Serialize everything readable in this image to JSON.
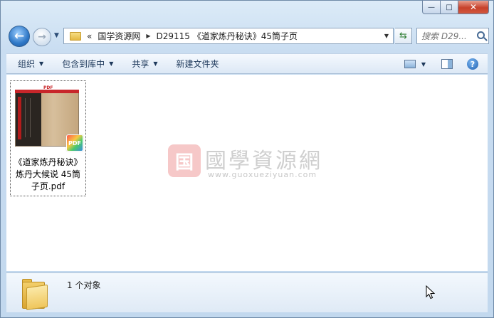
{
  "window": {
    "controls": {
      "minimize": "—",
      "maximize": "□",
      "close": "✕"
    }
  },
  "nav": {
    "back_glyph": "←",
    "forward_glyph": "→",
    "history_glyph": "▼",
    "address": {
      "overflow": "«",
      "segments": [
        "国学资源网",
        "D29115 《道家炼丹秘诀》45筒子页"
      ],
      "separator": "▶",
      "dropdown_glyph": "▼"
    },
    "refresh_glyph": "⇆",
    "search": {
      "placeholder": "搜索 D29..."
    }
  },
  "toolbar": {
    "organize": "组织",
    "include_in_library": "包含到库中",
    "share": "共享",
    "new_folder": "新建文件夹",
    "caret": "▼",
    "help": "?"
  },
  "files": [
    {
      "name": "《道家炼丹秘诀》炼丹大候说 45筒子页.pdf",
      "name_lines": [
        "《道家炼丹秘诀》",
        "炼丹大候说 45筒",
        "子页.pdf"
      ],
      "badge": "PDF",
      "thumb_label": "PDF"
    }
  ],
  "watermark": {
    "seal": "国",
    "title": "國學資源網",
    "url": "www.guoxueziyuan.com"
  },
  "status": {
    "count": "1 个对象"
  },
  "colors": {
    "window_frame": "#c2d8ee",
    "close_button": "#c7412b",
    "toolbar_text": "#1e395b"
  }
}
